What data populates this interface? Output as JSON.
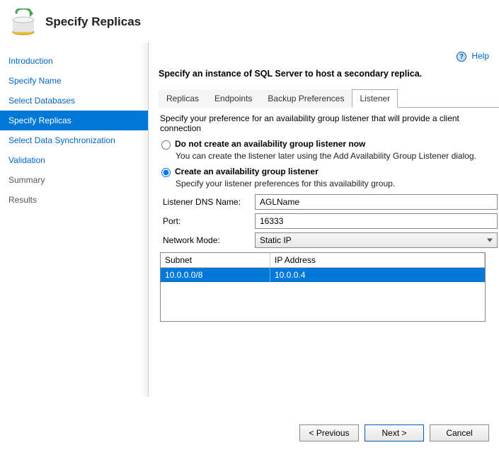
{
  "header": {
    "title": "Specify Replicas"
  },
  "help": {
    "label": "Help"
  },
  "sidebar": {
    "items": [
      {
        "label": "Introduction"
      },
      {
        "label": "Specify Name"
      },
      {
        "label": "Select Databases"
      },
      {
        "label": "Specify Replicas"
      },
      {
        "label": "Select Data Synchronization"
      },
      {
        "label": "Validation"
      },
      {
        "label": "Summary"
      },
      {
        "label": "Results"
      }
    ],
    "active_index": 3
  },
  "content": {
    "instruction": "Specify an instance of SQL Server to host a secondary replica.",
    "tabs": [
      {
        "label": "Replicas"
      },
      {
        "label": "Endpoints"
      },
      {
        "label": "Backup Preferences"
      },
      {
        "label": "Listener"
      }
    ],
    "active_tab_index": 3,
    "listener": {
      "pref_desc": "Specify your preference for an availability group listener that will provide a client connection",
      "opt_no_label": "Do not create an availability group listener now",
      "opt_no_sub": "You can create the listener later using the Add Availability Group Listener dialog.",
      "opt_yes_label": "Create an availability group listener",
      "opt_yes_sub": "Specify your listener preferences for this availability group.",
      "selected": "create",
      "dns_label": "Listener DNS Name:",
      "dns_value": "AGLName",
      "port_label": "Port:",
      "port_value": "16333",
      "mode_label": "Network Mode:",
      "mode_value": "Static IP",
      "grid": {
        "headers": {
          "subnet": "Subnet",
          "ip": "IP Address"
        },
        "rows": [
          {
            "subnet": "10.0.0.0/8",
            "ip": "10.0.0.4"
          }
        ]
      }
    }
  },
  "footer": {
    "previous": "< Previous",
    "next": "Next >",
    "cancel": "Cancel"
  }
}
